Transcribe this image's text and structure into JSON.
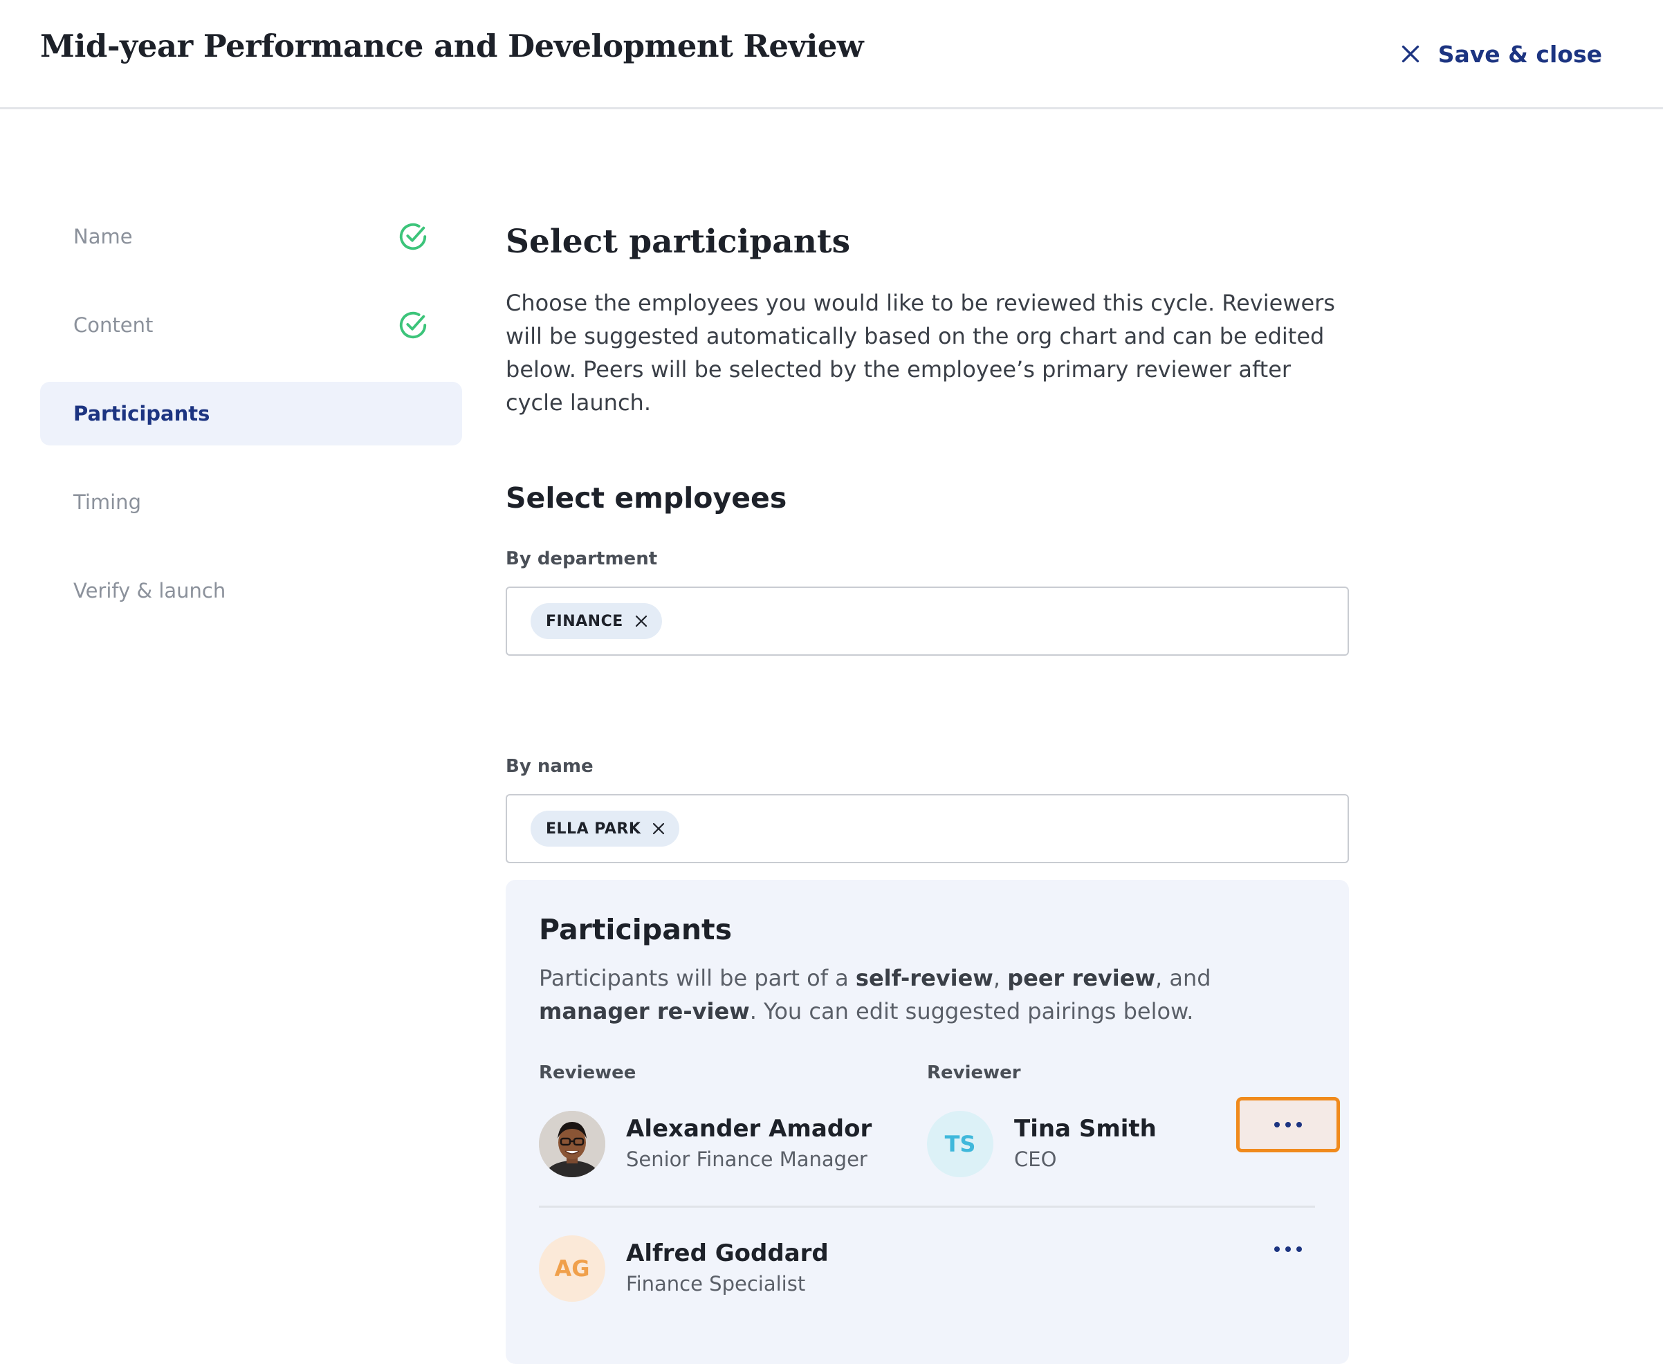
{
  "header": {
    "title": "Mid-year Performance and Development Review",
    "save_close_label": "Save & close"
  },
  "sidebar": {
    "items": [
      {
        "label": "Name",
        "completed": true
      },
      {
        "label": "Content",
        "completed": true
      },
      {
        "label": "Participants",
        "active": true
      },
      {
        "label": "Timing"
      },
      {
        "label": "Verify & launch"
      }
    ]
  },
  "main": {
    "title": "Select participants",
    "intro": "Choose the employees you would like to be reviewed this cycle. Reviewers will be suggested automatically based on the org chart and can be edited below. Peers will be selected by the employee’s primary reviewer after cycle launch.",
    "select_employees_title": "Select employees",
    "by_department": {
      "label": "By department",
      "chip": "FINANCE"
    },
    "by_name": {
      "label": "By name",
      "chip": "ELLA PARK"
    }
  },
  "participants": {
    "title": "Participants",
    "desc_part1": "Participants will be part of a ",
    "desc_b1": "self-review",
    "desc_sep1": ", ",
    "desc_b2": "peer review",
    "desc_sep2": ", and ",
    "desc_b3": "manager re-view",
    "desc_part2": ". You can edit suggested pairings below.",
    "col_reviewee": "Reviewee",
    "col_reviewer": "Reviewer",
    "rows": [
      {
        "reviewee": {
          "name": "Alexander Amador",
          "role": "Senior Finance Manager",
          "avatar": "photo"
        },
        "reviewer": {
          "name": "Tina Smith",
          "role": "CEO",
          "initials": "TS"
        }
      },
      {
        "reviewee": {
          "name": "Alfred Goddard",
          "role": "Finance Specialist",
          "initials": "AG"
        }
      }
    ]
  },
  "colors": {
    "accent": "#1c3481",
    "success": "#3cc47a",
    "highlight": "#f08a1c"
  },
  "icons": {
    "close": "close-icon",
    "check": "check-circle-icon",
    "more": "more-horizontal-icon"
  }
}
